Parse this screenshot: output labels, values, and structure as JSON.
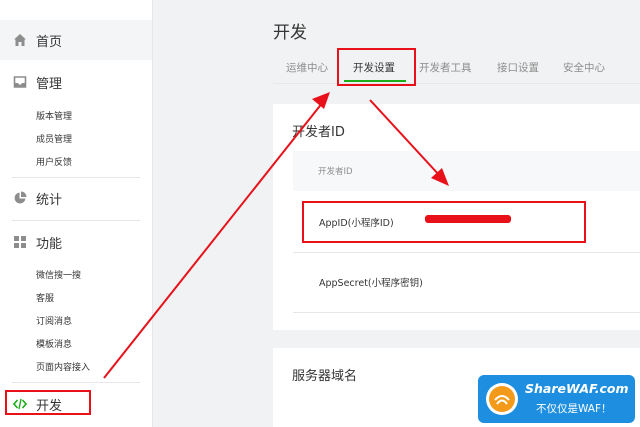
{
  "sidebar": {
    "home": "首页",
    "manage": {
      "label": "管理",
      "items": [
        "版本管理",
        "成员管理",
        "用户反馈"
      ]
    },
    "stats": "统计",
    "features": {
      "label": "功能",
      "items": [
        "微信搜一搜",
        "客服",
        "订阅消息",
        "模板消息",
        "页面内容接入"
      ]
    },
    "develop": "开发"
  },
  "header": {
    "title": "开发"
  },
  "tabs": [
    "运维中心",
    "开发设置",
    "开发者工具",
    "接口设置",
    "安全中心"
  ],
  "active_tab": "开发设置",
  "developer_id": {
    "title": "开发者ID",
    "column_header": "开发者ID",
    "rows": [
      "AppID(小程序ID)",
      "AppSecret(小程序密钥)"
    ]
  },
  "server_domain": {
    "title": "服务器域名"
  },
  "watermark": {
    "line1": "ShareWAF.com",
    "line2": "不仅仅是WAF！"
  },
  "colors": {
    "accent": "#1aad19",
    "annotation": "#e8111a",
    "watermark": "#1e8fe0"
  },
  "icons": [
    "home-icon",
    "inbox-icon",
    "pie-chart-icon",
    "grid-icon",
    "code-icon"
  ]
}
